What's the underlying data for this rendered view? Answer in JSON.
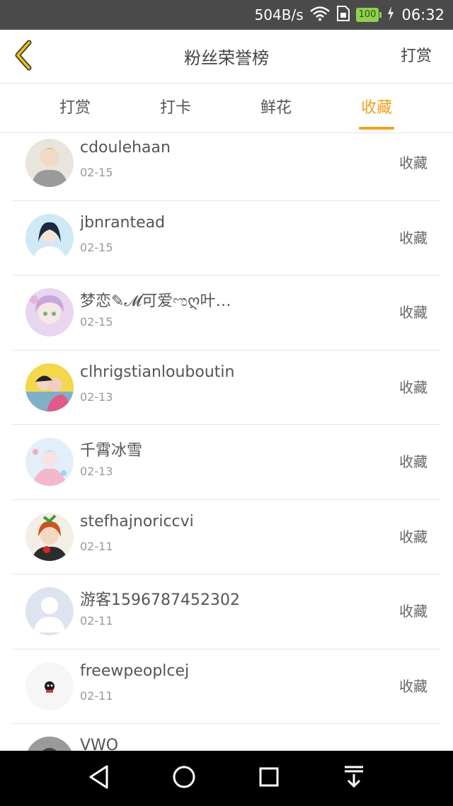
{
  "status": {
    "net_speed": "504B/s",
    "battery": "100",
    "time": "06:32"
  },
  "header": {
    "title": "粉丝荣誉榜",
    "action_label": "打赏"
  },
  "tabs": [
    {
      "label": "打赏",
      "active": false
    },
    {
      "label": "打卡",
      "active": false
    },
    {
      "label": "鲜花",
      "active": false
    },
    {
      "label": "收藏",
      "active": true
    }
  ],
  "list": [
    {
      "name": "cdoulehaan",
      "date": "02-15",
      "action": "收藏"
    },
    {
      "name": "jbnrantead",
      "date": "02-15",
      "action": "收藏"
    },
    {
      "name": "梦恋✎𝓜可爱ಌღ叶…",
      "date": "02-15",
      "action": "收藏"
    },
    {
      "name": "clhrigstianlouboutin",
      "date": "02-13",
      "action": "收藏"
    },
    {
      "name": "千霄冰雪",
      "date": "02-13",
      "action": "收藏"
    },
    {
      "name": "stefhajnoriccvi",
      "date": "02-11",
      "action": "收藏"
    },
    {
      "name": "游客1596787452302",
      "date": "02-11",
      "action": "收藏"
    },
    {
      "name": "freewpeoplcej",
      "date": "02-11",
      "action": "收藏"
    },
    {
      "name": "VWO",
      "date": "",
      "action": ""
    }
  ],
  "colors": {
    "accent": "#f0a020",
    "status_bar": "#4a4a4a",
    "nav_bar": "#000000"
  }
}
